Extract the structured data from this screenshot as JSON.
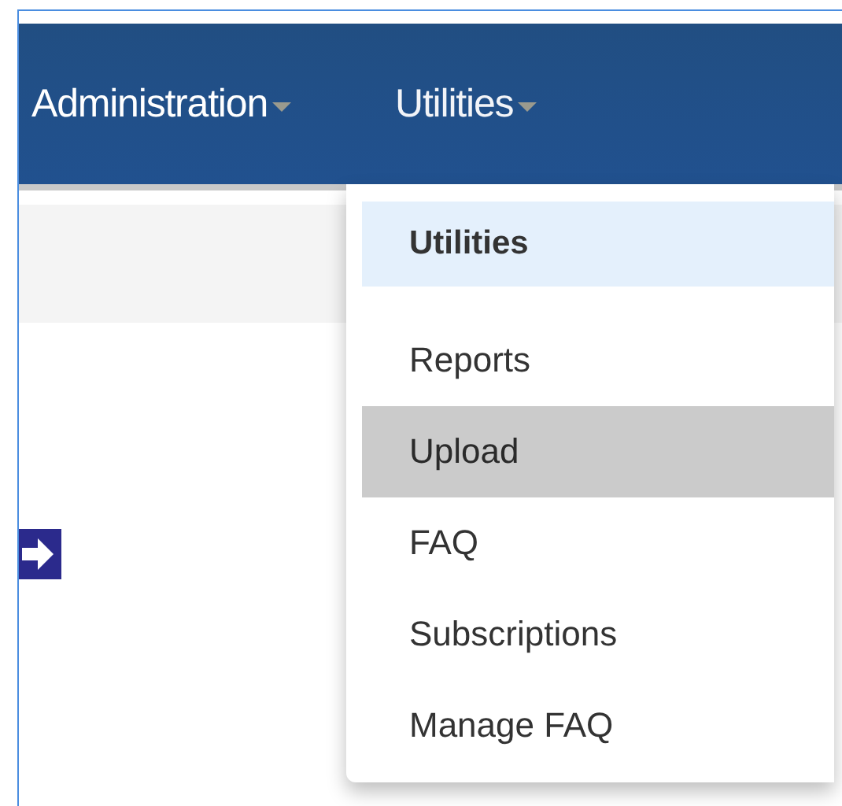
{
  "navbar": {
    "items": [
      {
        "label": "Administration",
        "expanded": false
      },
      {
        "label": "Utilities",
        "expanded": true,
        "menu": [
          {
            "kind": "header",
            "label": "Utilities"
          },
          {
            "kind": "item",
            "label": "Reports",
            "selected": false
          },
          {
            "kind": "item",
            "label": "Upload",
            "selected": true
          },
          {
            "kind": "item",
            "label": "FAQ",
            "selected": false
          },
          {
            "kind": "item",
            "label": "Subscriptions",
            "selected": false
          },
          {
            "kind": "item",
            "label": "Manage FAQ",
            "selected": false
          }
        ]
      }
    ]
  }
}
